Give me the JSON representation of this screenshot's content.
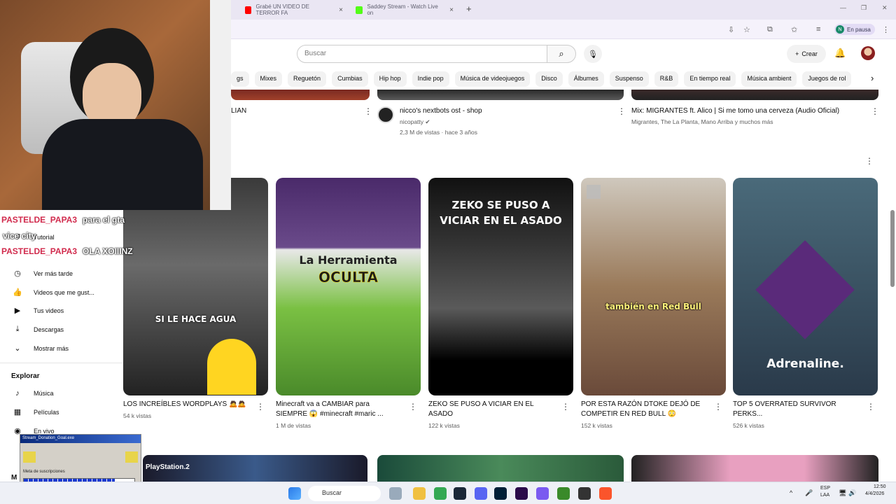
{
  "browser": {
    "tabs": [
      {
        "title": "Grabé UN VIDEO DE TERROR FA",
        "color": "#ff0000"
      },
      {
        "title": "Saddey Stream - Watch Live on",
        "color": "#53fc18"
      }
    ],
    "profile_initial": "N",
    "profile_status": "En pausa"
  },
  "youtube": {
    "search_placeholder": "Buscar",
    "create_label": "Crear",
    "chips": [
      "gs",
      "Mixes",
      "Reguetón",
      "Cumbias",
      "Hip hop",
      "Indie pop",
      "Música de videojuegos",
      "Disco",
      "Álbumes",
      "Suspenso",
      "R&B",
      "En tiempo real",
      "Música ambient",
      "Juegos de rol"
    ],
    "top_row": [
      {
        "title": "LIAN",
        "channel": "",
        "meta": ""
      },
      {
        "title": "nicco's nextbots ost - shop",
        "channel": "nicopatty",
        "meta": "2,3 M de vistas · hace 3 años"
      },
      {
        "title": "Mix: MIGRANTES ft. Alico | Si me tomo una cerveza (Audio Oficial)",
        "channel": "Migrantes, The La Planta, Mano Arriba y muchos más",
        "meta": ""
      }
    ],
    "shorts": [
      {
        "title": "LOS INCREÍBLES WORDPLAYS 🙇🙇",
        "views": "54 k vistas",
        "overlay": "SI LE HACE AGUA"
      },
      {
        "title": "Minecraft va a CAMBIAR para SIEMPRE 😱 #minecraft #maric ...",
        "views": "1 M de vistas",
        "overlay1": "La Herramienta",
        "overlay2": "OCULTA"
      },
      {
        "title": "ZEKO SE PUSO A VICIAR EN EL ASADO",
        "views": "122 k vistas",
        "overlay": "ZEKO SE PUSO A VICIAR EN EL ASADO"
      },
      {
        "title": "POR ESTA RAZÓN DTOKE DEJÓ DE COMPETIR EN RED BULL 😳",
        "views": "152 k vistas",
        "overlay": "también en Red Bull"
      },
      {
        "title": "TOP 5 OVERRATED SURVIVOR PERKS...",
        "views": "526 k vistas",
        "overlay": "Adrenaline."
      }
    ]
  },
  "sidebar": {
    "items": [
      "Tutorial",
      "Ver más tarde",
      "Videos que me gust...",
      "Tus videos",
      "Descargas",
      "Mostrar más"
    ],
    "explore_header": "Explorar",
    "explore": [
      "Música",
      "Películas",
      "En vivo"
    ],
    "bottom_partial": "M"
  },
  "chat": [
    {
      "user": "PASTELDE_PAPA3",
      "msg": "para el gta"
    },
    {
      "user": "PASTELDE_PAPA3",
      "msg": "OLA XOIIINZ"
    }
  ],
  "chat_fragment": "vice city",
  "donation": {
    "window_title": "Stream_Donation_Goal.exe",
    "label": "Meta de suscripciones",
    "progress": 0.82
  },
  "bottom_row": {
    "playstation_label": "PlayStation.2"
  },
  "taskbar": {
    "search": "Buscar",
    "lang1": "ESP",
    "lang2": "LAA",
    "time": "12:50",
    "date": "4/4/2026"
  }
}
